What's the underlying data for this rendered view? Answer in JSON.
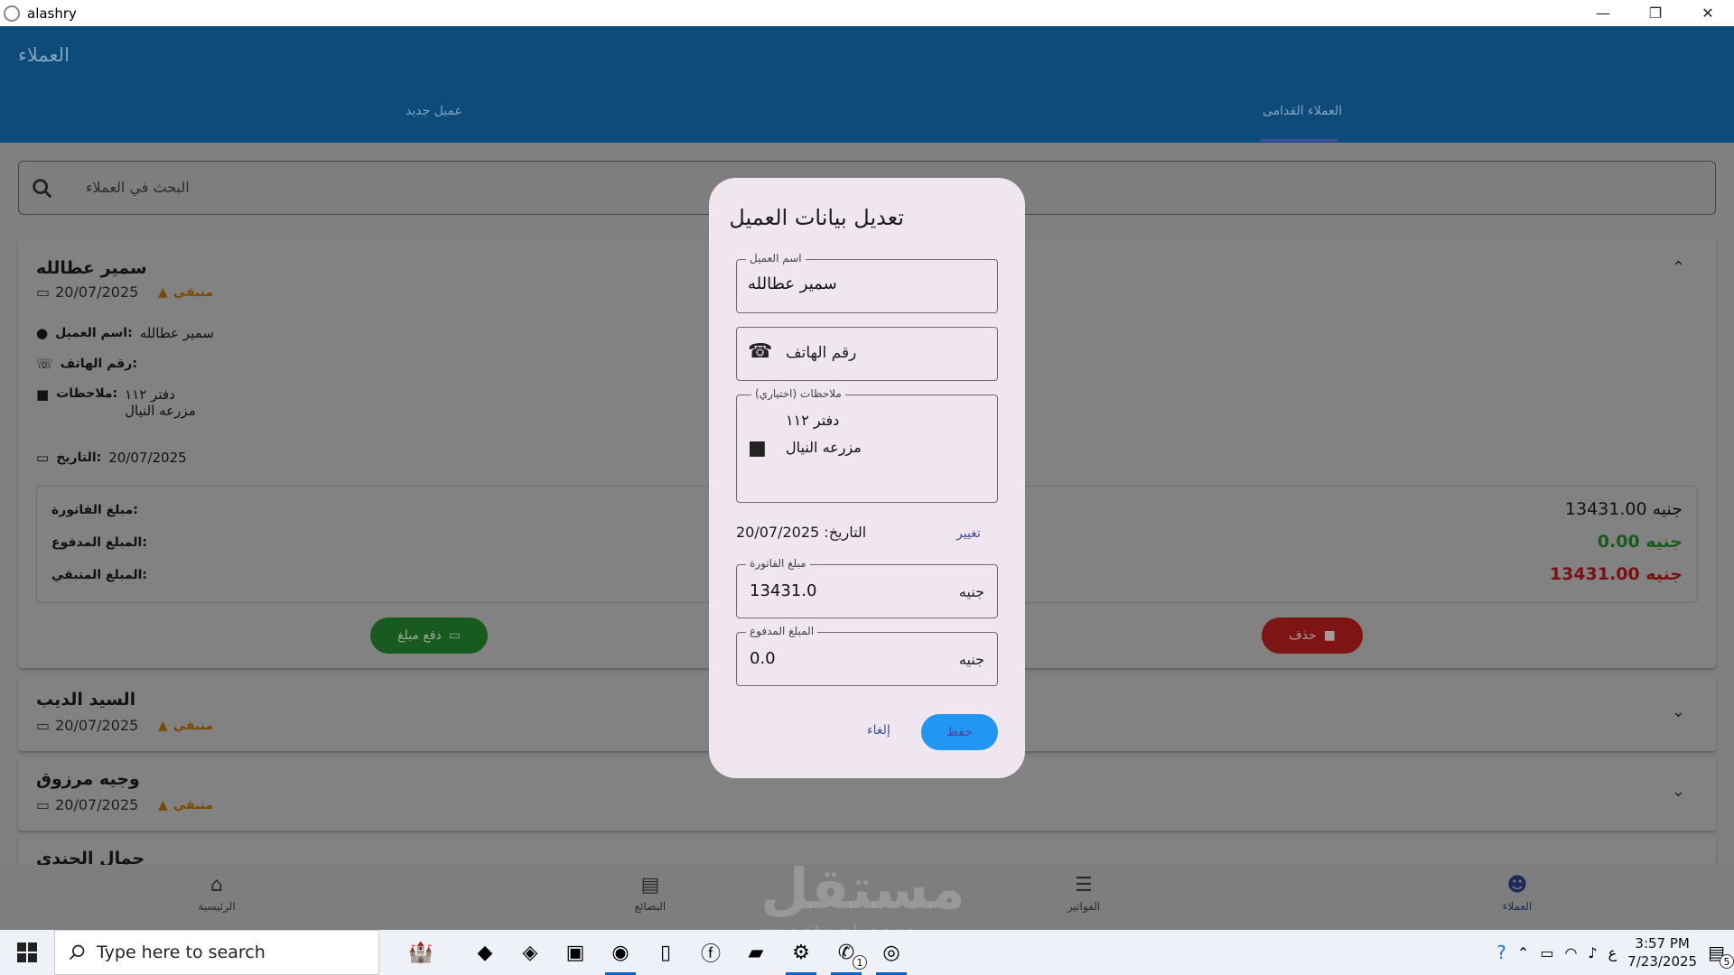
{
  "window": {
    "title": "alashry",
    "minimize": "—",
    "restore": "❐",
    "close": "✕"
  },
  "appbar": {
    "page_title": "العملاء",
    "tabs": [
      {
        "label": "العملاء القدامى"
      },
      {
        "label": "عميل جديد"
      }
    ]
  },
  "search": {
    "placeholder": "البحث في العملاء"
  },
  "customers": [
    {
      "name": "سمير عطالله",
      "date": "20/07/2025",
      "status": "متبقي",
      "details": {
        "name_label": "اسم العميل:",
        "name_value": "سمير عطالله",
        "phone_label": "رقم الهاتف:",
        "notes_label": "ملاحظات:",
        "notes_line1": "دفتر ١١٢",
        "notes_line2": "مزرعه النيال",
        "date_label": "التاريخ:",
        "date_value": "20/07/2025"
      },
      "amounts": {
        "invoice_label": "مبلغ الفاتورة:",
        "invoice_value": "13431.00 جنيه",
        "paid_label": "المبلغ المدفوع:",
        "paid_value": "0.00 جنيه",
        "remaining_label": "المبلغ المتبقي:",
        "remaining_value": "13431.00 جنيه"
      },
      "pay_button": "دفع مبلغ",
      "delete_button": "حذف"
    },
    {
      "name": "السيد الديب",
      "date": "20/07/2025",
      "status": "متبقي"
    },
    {
      "name": "وجيه مرزوق",
      "date": "20/07/2025",
      "status": "متبقي"
    },
    {
      "name": "جمال الجندي"
    }
  ],
  "bottom_nav": [
    {
      "label": "الرئيسية"
    },
    {
      "label": "البضائع"
    },
    {
      "label": "الفواتير"
    },
    {
      "label": "العملاء"
    }
  ],
  "dialog": {
    "title": "تعديل بيانات العميل",
    "name_label": "اسم العميل",
    "name_value": "سمير عطالله",
    "phone_placeholder": "رقم الهاتف",
    "notes_label": "ملاحظات (اختياري)",
    "notes_line1": "دفتر ١١٢",
    "notes_line2": "مزرعه النيال",
    "date_text": "التاريخ: 20/07/2025",
    "change_label": "تغيير",
    "invoice_label": "مبلغ الفاتورة",
    "invoice_value": "13431.0",
    "currency": "جنيه",
    "paid_label": "المبلغ المدفوع",
    "paid_value": "0.0",
    "cancel_label": "إلغاء",
    "save_label": "حفظ"
  },
  "watermark": {
    "text": "مستقل",
    "sub": "mostaql.com"
  },
  "taskbar": {
    "search_placeholder": "Type here to search",
    "whatsapp_badge": "1",
    "lang": "ع",
    "time": "3:57 PM",
    "date": "7/23/2025",
    "notif_count": "5"
  },
  "colors": {
    "appbar": "#0c4b7a",
    "accent": "#2196f3",
    "pay": "#185a1f",
    "delete": "#7f1414",
    "warning": "#e39a00"
  }
}
